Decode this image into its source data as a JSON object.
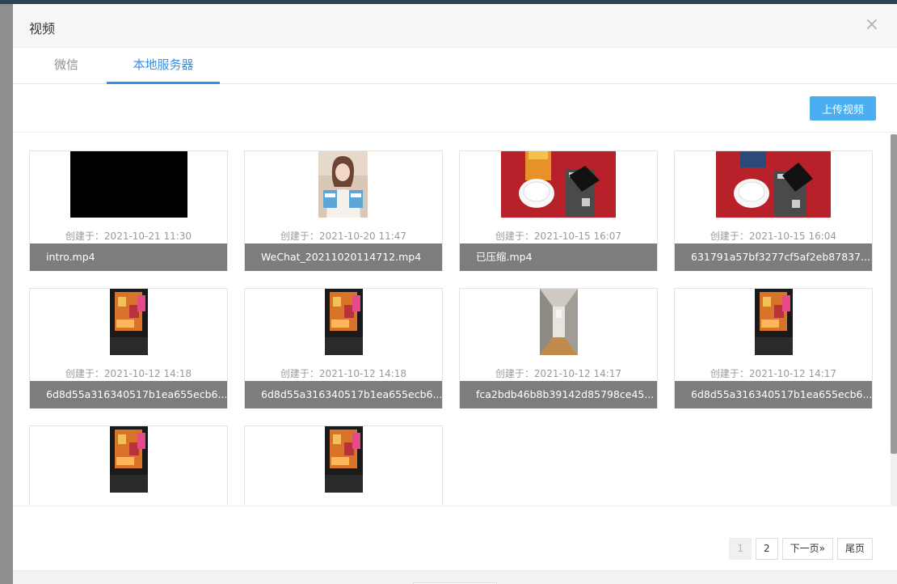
{
  "modal": {
    "title": "视频",
    "close_glyph": "×"
  },
  "tabs": [
    {
      "label": "微信",
      "active": false
    },
    {
      "label": "本地服务器",
      "active": true
    }
  ],
  "toolbar": {
    "upload_label": "上传视频"
  },
  "videos": [
    {
      "date": "创建于：2021-10-21 11:30",
      "name": "intro.mp4"
    },
    {
      "date": "创建于：2021-10-20 11:47",
      "name": "WeChat_20211020114712.mp4"
    },
    {
      "date": "创建于：2021-10-15 16:07",
      "name": "已压缩.mp4"
    },
    {
      "date": "创建于：2021-10-15 16:04",
      "name": "631791a57bf3277cf5af2eb87837..."
    },
    {
      "date": "创建于：2021-10-12 14:18",
      "name": "6d8d55a316340517b1ea655ecb6..."
    },
    {
      "date": "创建于：2021-10-12 14:18",
      "name": "6d8d55a316340517b1ea655ecb6..."
    },
    {
      "date": "创建于：2021-10-12 14:17",
      "name": "fca2bdb46b8b39142d85798ce45..."
    },
    {
      "date": "创建于：2021-10-12 14:17",
      "name": "6d8d55a316340517b1ea655ecb6..."
    },
    {
      "date": "",
      "name": ""
    },
    {
      "date": "",
      "name": ""
    }
  ],
  "pagination": {
    "pages": [
      "1",
      "2"
    ],
    "current": "1",
    "next_label": "下一页»",
    "last_label": "尾页"
  },
  "colors": {
    "accent": "#3a8ee6",
    "upload_button": "#4aaef0",
    "name_bar": "#7d7d7d"
  }
}
